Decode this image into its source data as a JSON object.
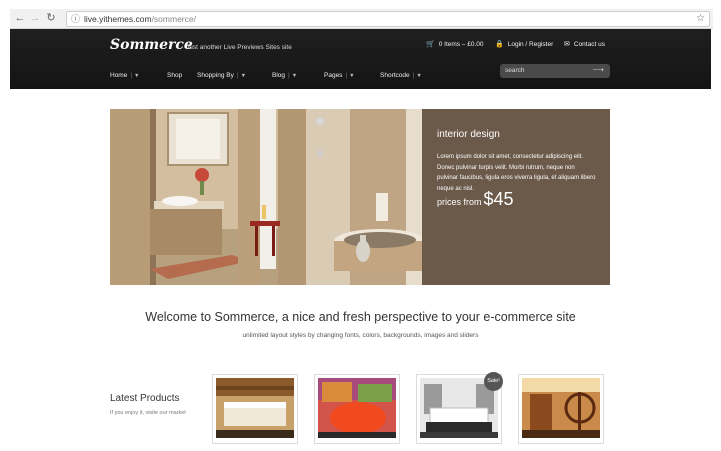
{
  "browser": {
    "url_domain": "live.yithemes.com",
    "url_path": "/sommerce/",
    "back_icon": "arrow-left-icon",
    "forward_icon": "arrow-right-icon",
    "reload_icon": "reload-icon",
    "page_icon": "info-icon",
    "bookmark_icon": "star-icon"
  },
  "header": {
    "logo": "Sommerce",
    "tagline": "Just another Live Previews Sites site",
    "cart": "0 Items – £0.00",
    "login": "Login / Register",
    "contact": "Contact us",
    "search_placeholder": "search",
    "nav": [
      {
        "label": "Home",
        "dropdown": true
      },
      {
        "label": "Shop",
        "dropdown": false
      },
      {
        "label": "Shopping By",
        "dropdown": true
      },
      {
        "label": "Blog",
        "dropdown": true
      },
      {
        "label": "Pages",
        "dropdown": true
      },
      {
        "label": "Shortcode",
        "dropdown": true
      }
    ]
  },
  "slider": {
    "title": "interior design",
    "text": "Lorem ipsum dolor sit amet, consectetur adipiscing elit. Donec pulvinar turpis velit. Morbi rutrum, neque non pulvinar faucibus, ligula eros viverra ligula, et aliquam libero neque ac nisl.",
    "price_label": "prices from",
    "price_value": "$45"
  },
  "welcome": {
    "title": "Welcome to Sommerce, a nice and fresh perspective to your e-commerce site",
    "subtitle": "unlimited layout styles by changing fonts, colors, backgrounds, images and sliders"
  },
  "latest_products": {
    "title": "Latest Products",
    "subtitle": "If you enjoy it, visite our market",
    "sale_badge": "Sale!"
  }
}
